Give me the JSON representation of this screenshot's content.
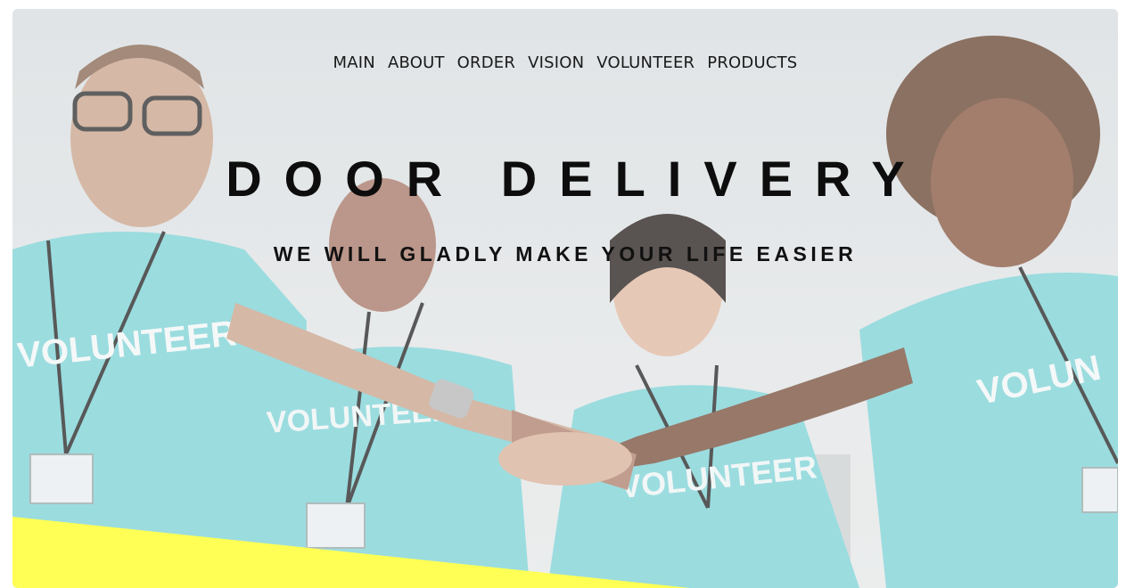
{
  "nav": {
    "items": [
      {
        "label": "MAIN"
      },
      {
        "label": "ABOUT"
      },
      {
        "label": "ORDER"
      },
      {
        "label": "VISION"
      },
      {
        "label": "VOLUNTEER"
      },
      {
        "label": "PRODUCTS"
      }
    ]
  },
  "hero": {
    "title": "DOOR DELIVERY",
    "subtitle": "WE WILL GLADLY MAKE YOUR LIFE EASIER",
    "shirt_text": "VOLUNTEER"
  },
  "colors": {
    "accent": "#ffff55",
    "shirt": "#7fd3d6",
    "text": "#111111"
  }
}
